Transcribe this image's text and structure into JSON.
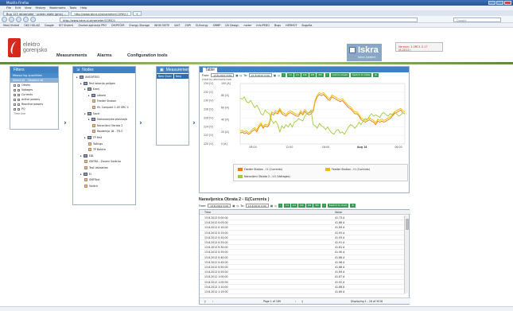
{
  "browser": {
    "title": "Mozilla Firefox",
    "menu": [
      "File",
      "Edit",
      "View",
      "History",
      "Bookmarks",
      "Tools",
      "Help"
    ],
    "tabs": [
      "Bug 123 iskrameter · screen state (gmc) ...",
      "http://www.iskra.si/skrameter/CORE/CI"
    ],
    "url": "http://www.iskra-si.skrameter/CORE/1",
    "search_placeholder": "Google",
    "bookmarks": [
      "Most Visited",
      "OKO HGLAD",
      "Google",
      "IGT Sistemi",
      "Zaveza aginacija PRO",
      "DISPEČER",
      "Energy Storage",
      "WHIS SISTE",
      "SAIT",
      "ZUPI",
      "ELEnergy",
      "SMMP",
      "DS Design",
      "meter",
      "Info:PEDO",
      "Bugs",
      "HERMOT",
      "Bugzilla"
    ]
  },
  "app": {
    "brand_line1": "elektro",
    "brand_line2": "gorenjsko",
    "nav": [
      "Measurements",
      "Alarms",
      "Configuration tools"
    ],
    "partner": "Iskra",
    "partner_sub": "Iskra Sistemi",
    "version": "Version: 1.0RC1.3.17 (8.2012)"
  },
  "filters": {
    "title": "Filters",
    "subtitle": "Measuring quantities",
    "select_all": "Select all",
    "deselect_all": "Deselect all",
    "items": [
      "Others",
      "Voltages",
      "Currents",
      "Active powers",
      "Reactive powers",
      "PQ"
    ],
    "footer": "Time line"
  },
  "nodes": {
    "title": "Nodes",
    "tree": [
      {
        "label": "UNSORTED",
        "indent": 0,
        "kind": "group"
      },
      {
        "label": "Test lokacija poligon",
        "indent": 1,
        "kind": "group"
      },
      {
        "label": "Kranj",
        "indent": 2,
        "kind": "group"
      },
      {
        "label": "Labora",
        "indent": 3,
        "kind": "group"
      },
      {
        "label": "Feeder Station",
        "indent": 4,
        "kind": "device"
      },
      {
        "label": "Ht. Compact 1.05 SRC 2",
        "indent": 4,
        "kind": "device"
      },
      {
        "label": "Savci",
        "indent": 2,
        "kind": "group"
      },
      {
        "label": "Stanovanjska proizvaja",
        "indent": 3,
        "kind": "group"
      },
      {
        "label": "Naravljeni Obrata 2",
        "indent": 4,
        "kind": "device"
      },
      {
        "label": "Razdelnja 16 - TR-3",
        "indent": 4,
        "kind": "device"
      },
      {
        "label": "TP test",
        "indent": 2,
        "kind": "group"
      },
      {
        "label": "Tollings",
        "indent": 3,
        "kind": "device"
      },
      {
        "label": "TP Baktre",
        "indent": 3,
        "kind": "device"
      },
      {
        "label": "EDL",
        "indent": 1,
        "kind": "group"
      },
      {
        "label": "ISKTRA - Zaveni Switcha",
        "indent": 2,
        "kind": "device"
      },
      {
        "label": "Test Validation",
        "indent": 2,
        "kind": "device"
      },
      {
        "label": "EI",
        "indent": 1,
        "kind": "group"
      },
      {
        "label": "SMFTest",
        "indent": 2,
        "kind": "device"
      },
      {
        "label": "Switch",
        "indent": 2,
        "kind": "device"
      }
    ]
  },
  "measurements": {
    "title": "Measurements",
    "new_chart": "New Chart",
    "new_table": "New Table"
  },
  "chart_toolbar": {
    "tab": "Table",
    "from_label": "From:",
    "from_value": "13.8.2012 0:00",
    "to_label": "To:",
    "to_value": "21.8.2012 0:00",
    "ranges": [
      "1d",
      "2d",
      "1W",
      "2M",
      "3M"
    ],
    "add_to_sheet": "Add to sheet",
    "switch_to_table": "Switch to table",
    "credit": "chart by amcharts.com"
  },
  "chart_data": {
    "type": "line",
    "left_axis": {
      "label": "[V]",
      "ticks": [
        "234 [V]",
        "232 [V]",
        "230 [V]",
        "228 [V]",
        "226 [V]",
        "224 [V]",
        "222 [V]",
        "220 [V]"
      ]
    },
    "right_axis": {
      "label": "[A]",
      "ticks": [
        "100 [A]",
        "80 [A]",
        "60 [A]",
        "40 [A]",
        "20 [A]",
        "0 [A]"
      ]
    },
    "x_ticks": [
      "06:00",
      "12:00",
      "18:00",
      "Aug 14",
      "06:00"
    ],
    "series": [
      {
        "name": "Feeder Station - I1 (Currents)",
        "color": "#f07818",
        "values": [
          118,
          120,
          117,
          119,
          116,
          118,
          122,
          124,
          120,
          128,
          132,
          126,
          130,
          128,
          132,
          150,
          148,
          152,
          150,
          156,
          150,
          148,
          146,
          150,
          152,
          150,
          148,
          146,
          146,
          152,
          148,
          154,
          150,
          148,
          150,
          154,
          170,
          178,
          182,
          180,
          182,
          178,
          174,
          172,
          178,
          176,
          174,
          172,
          170,
          172,
          168,
          164,
          160,
          158,
          154,
          150,
          150,
          146,
          140,
          138,
          136,
          138,
          140,
          138,
          136,
          132,
          138,
          136,
          138,
          136,
          138,
          140,
          142,
          146,
          150,
          152,
          154,
          156,
          152,
          150
        ]
      },
      {
        "name": "Feeder Station - I1 (Currents)",
        "color": "#e8c000",
        "values": [
          121,
          123,
          120,
          122,
          119,
          121,
          125,
          127,
          123,
          131,
          135,
          129,
          133,
          131,
          135,
          153,
          151,
          155,
          153,
          159,
          153,
          151,
          149,
          153,
          155,
          153,
          151,
          149,
          149,
          155,
          151,
          157,
          153,
          151,
          153,
          157,
          173,
          181,
          185,
          183,
          185,
          181,
          177,
          175,
          181,
          179,
          177,
          175,
          173,
          175,
          171,
          167,
          163,
          161,
          157,
          153,
          153,
          149,
          143,
          141,
          139,
          141,
          143,
          141,
          139,
          135,
          141,
          139,
          141,
          139,
          141,
          143,
          145,
          149,
          153,
          155,
          157,
          159,
          155,
          153
        ]
      },
      {
        "name": "Naravljeni Obrata 2 - U1 (Voltages)",
        "color": "#9ccc3c",
        "values": [
          176,
          174,
          178,
          170,
          168,
          172,
          166,
          160,
          164,
          158,
          150,
          148,
          156,
          152,
          150,
          140,
          134,
          138,
          132,
          120,
          130,
          126,
          132,
          128,
          134,
          128,
          136,
          138,
          142,
          140,
          138,
          146,
          150,
          152,
          156,
          132,
          130,
          126,
          134,
          130,
          128,
          124,
          128,
          122,
          118,
          116,
          122,
          124,
          118,
          120,
          116,
          122,
          128,
          132,
          130,
          126,
          130,
          136,
          132,
          138,
          142,
          140,
          146,
          150,
          146,
          148,
          146,
          144,
          150,
          152,
          148,
          146,
          150,
          148,
          152,
          150,
          146,
          148,
          152,
          150
        ]
      }
    ]
  },
  "table": {
    "title": "Naravljenica Obrata 2 - I1(Currents )",
    "from_label": "From:",
    "from_value": "13.8.2012 0:00",
    "to_label": "To:",
    "to_value": "14.8.2012 0:00",
    "ranges": [
      "1d",
      "2d",
      "1W",
      "2M",
      "3M"
    ],
    "switch_to_chart": "Switch to chart",
    "columns": [
      "Time",
      "Value"
    ],
    "rows": [
      [
        "13.8.2012 0:00:00",
        "41.73 A"
      ],
      [
        "13.8.2012 0:05:00",
        "41.88 A"
      ],
      [
        "13.8.2012 0:10:00",
        "41.89 A"
      ],
      [
        "13.8.2012 0:15:00",
        "41.93 A"
      ],
      [
        "13.8.2012 0:20:00",
        "41.93 A"
      ],
      [
        "13.8.2012 0:25:00",
        "41.91 A"
      ],
      [
        "13.8.2012 0:30:00",
        "41.81 A"
      ],
      [
        "13.8.2012 0:35:00",
        "41.90 A"
      ],
      [
        "13.8.2012 0:40:00",
        "41.88 A"
      ],
      [
        "13.8.2012 0:45:00",
        "41.96 A"
      ],
      [
        "13.8.2012 0:50:00",
        "41.88 A"
      ],
      [
        "13.8.2012 0:55:00",
        "41.89 A"
      ],
      [
        "13.8.2012 1:00:00",
        "41.87 A"
      ],
      [
        "13.8.2012 1:05:00",
        "41.92 A"
      ],
      [
        "13.8.2012 1:10:00",
        "41.88 A"
      ],
      [
        "13.8.2012 1:15:00",
        "41.89 A"
      ]
    ],
    "page_label": "Page 1 of 189",
    "display_label": "Displaying 1 - 16 of 3016"
  }
}
